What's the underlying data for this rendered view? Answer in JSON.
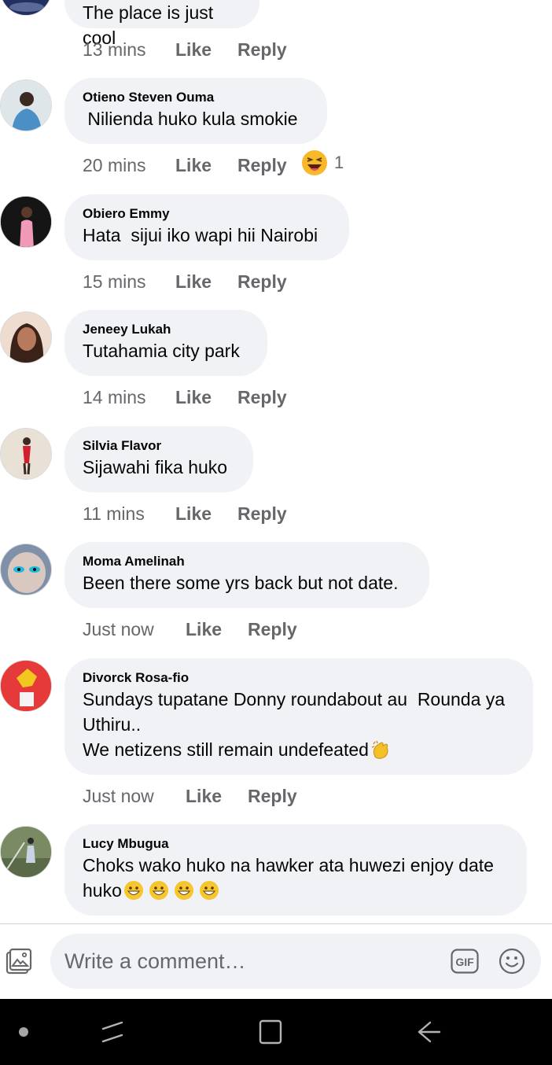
{
  "comments": [
    {
      "author": "",
      "text": "The place is just cool",
      "time": "13 mins",
      "like": "Like",
      "reply": "Reply"
    },
    {
      "author": "Otieno Steven Ouma",
      "text": " Nilienda huko kula smokie",
      "time": "20 mins",
      "like": "Like",
      "reply": "Reply",
      "reaction_icon": "laughing-emoji-icon",
      "reaction_count": "1"
    },
    {
      "author": "Obiero Emmy",
      "text": "Hata  sijui iko wapi hii Nairobi",
      "time": "15 mins",
      "like": "Like",
      "reply": "Reply"
    },
    {
      "author": "Jeneey Lukah",
      "text": "Tutahamia city park",
      "time": "14 mins",
      "like": "Like",
      "reply": "Reply"
    },
    {
      "author": "Silvia Flavor",
      "text": "Sijawahi fika huko",
      "time": "11 mins",
      "like": "Like",
      "reply": "Reply"
    },
    {
      "author": "Moma Amelinah",
      "text": "Been there some yrs back but not date.",
      "time": "Just now",
      "like": "Like",
      "reply": "Reply"
    },
    {
      "author": "Divorck Rosa-fio",
      "line1": "Sundays tupatane Donny roundabout au  Rounda ya",
      "line2": "Uthiru..",
      "line3": "We netizens still remain undefeated",
      "time": "Just now",
      "like": "Like",
      "reply": "Reply",
      "emoji_icon": "clapping-hands-emoji-icon"
    },
    {
      "author": "Lucy Mbugua",
      "line1": "Choks wako huko na hawker ata huwezi enjoy date",
      "line2": "huko",
      "emoji_icon": "grinning-face-emoji-icon"
    }
  ],
  "composer": {
    "placeholder": "Write a comment…",
    "photo_icon": "photo-icon",
    "gif_icon": "gif-icon",
    "emoji_icon": "smiley-icon"
  },
  "navbar": {
    "dot_icon": "dot-icon",
    "recent_icon": "recent-apps-icon",
    "home_icon": "home-icon",
    "back_icon": "back-icon"
  },
  "colors": {
    "bubble": "#f0f2f5",
    "meta_text": "#65676b",
    "text": "#050505",
    "navbar": "#000000"
  }
}
